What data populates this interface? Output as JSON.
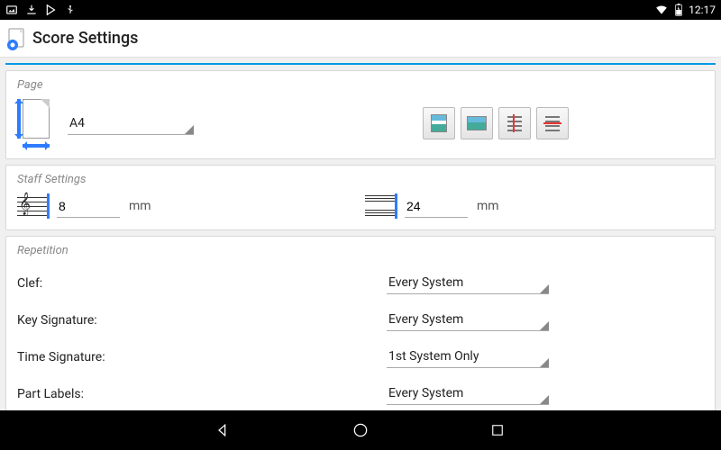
{
  "status": {
    "time": "12:17"
  },
  "header": {
    "title": "Score Settings"
  },
  "sections": {
    "page": {
      "title": "Page",
      "size_value": "A4"
    },
    "staff": {
      "title": "Staff Settings",
      "height_value": "8",
      "height_unit": "mm",
      "spacing_value": "24",
      "spacing_unit": "mm"
    },
    "repetition": {
      "title": "Repetition",
      "rows": [
        {
          "label": "Clef:",
          "value": "Every System"
        },
        {
          "label": "Key Signature:",
          "value": "Every System"
        },
        {
          "label": "Time Signature:",
          "value": "1st System Only"
        },
        {
          "label": "Part Labels:",
          "value": "Every System"
        }
      ]
    }
  }
}
